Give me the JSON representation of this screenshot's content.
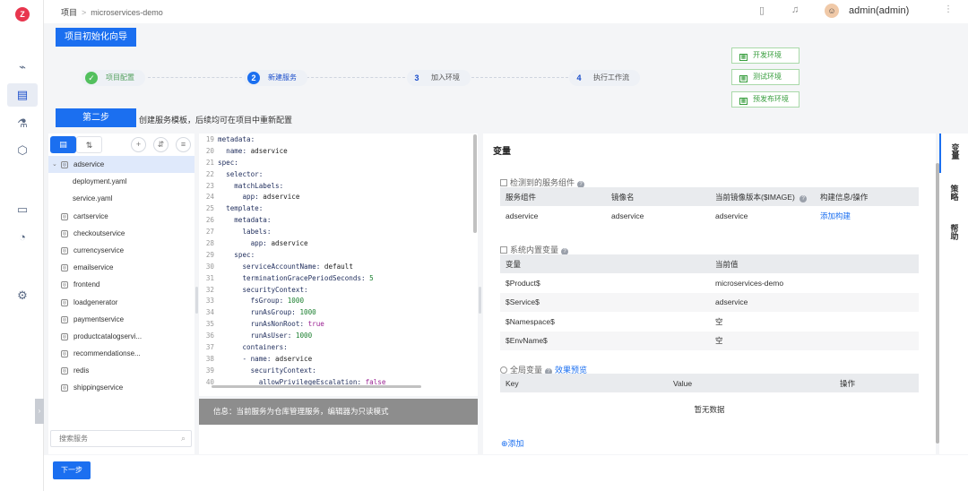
{
  "header": {
    "breadcrumb_root": "项目",
    "breadcrumb_sep": ">",
    "breadcrumb_current": "microservices-demo",
    "user_name": "admin(admin)"
  },
  "wizard": {
    "title_button": "项目初始化向导",
    "steps": [
      {
        "num": "✓",
        "label": "项目配置",
        "state": "done"
      },
      {
        "num": "2",
        "label": "新建服务",
        "state": "active"
      },
      {
        "num": "3",
        "label": "加入环境",
        "state": "todo"
      },
      {
        "num": "4",
        "label": "执行工作流",
        "state": "todo"
      }
    ],
    "env_buttons": [
      "开发环境",
      "测试环境",
      "预发布环境"
    ],
    "step_tag": "第二步",
    "step_desc": "创建服务模板，后续均可在项目中重新配置"
  },
  "services": {
    "selected": "adservice",
    "files": [
      "deployment.yaml",
      "service.yaml"
    ],
    "items": [
      "cartservice",
      "checkoutservice",
      "currencyservice",
      "emailservice",
      "frontend",
      "loadgenerator",
      "paymentservice",
      "productcatalogservi...",
      "recommendationse...",
      "redis",
      "shippingservice"
    ],
    "search_placeholder": "搜索服务"
  },
  "editor": {
    "lines": [
      {
        "n": "19",
        "indent": "",
        "key": "metadata:",
        "val": "",
        "type": "k"
      },
      {
        "n": "20",
        "indent": "  ",
        "key": "name:",
        "val": " adservice",
        "type": "v"
      },
      {
        "n": "21",
        "indent": "",
        "key": "spec:",
        "val": "",
        "type": "k"
      },
      {
        "n": "22",
        "indent": "  ",
        "key": "selector:",
        "val": "",
        "type": "k"
      },
      {
        "n": "23",
        "indent": "    ",
        "key": "matchLabels:",
        "val": "",
        "type": "k"
      },
      {
        "n": "24",
        "indent": "      ",
        "key": "app:",
        "val": " adservice",
        "type": "v"
      },
      {
        "n": "25",
        "indent": "  ",
        "key": "template:",
        "val": "",
        "type": "k"
      },
      {
        "n": "26",
        "indent": "    ",
        "key": "metadata:",
        "val": "",
        "type": "k"
      },
      {
        "n": "27",
        "indent": "      ",
        "key": "labels:",
        "val": "",
        "type": "k"
      },
      {
        "n": "28",
        "indent": "        ",
        "key": "app:",
        "val": " adservice",
        "type": "v"
      },
      {
        "n": "29",
        "indent": "    ",
        "key": "spec:",
        "val": "",
        "type": "k"
      },
      {
        "n": "30",
        "indent": "      ",
        "key": "serviceAccountName:",
        "val": " default",
        "type": "v"
      },
      {
        "n": "31",
        "indent": "      ",
        "key": "terminationGracePeriodSeconds:",
        "val": " 5",
        "type": "n"
      },
      {
        "n": "32",
        "indent": "      ",
        "key": "securityContext:",
        "val": "",
        "type": "k"
      },
      {
        "n": "33",
        "indent": "        ",
        "key": "fsGroup:",
        "val": " 1000",
        "type": "n"
      },
      {
        "n": "34",
        "indent": "        ",
        "key": "runAsGroup:",
        "val": " 1000",
        "type": "n"
      },
      {
        "n": "35",
        "indent": "        ",
        "key": "runAsNonRoot:",
        "val": " true",
        "type": "b"
      },
      {
        "n": "36",
        "indent": "        ",
        "key": "runAsUser:",
        "val": " 1000",
        "type": "n"
      },
      {
        "n": "37",
        "indent": "      ",
        "key": "containers:",
        "val": "",
        "type": "k"
      },
      {
        "n": "38",
        "indent": "      ",
        "key": "- name:",
        "val": " adservice",
        "type": "v"
      },
      {
        "n": "39",
        "indent": "        ",
        "key": "securityContext:",
        "val": "",
        "type": "k"
      },
      {
        "n": "40",
        "indent": "          ",
        "key": "allowPrivilegeEscalation:",
        "val": " false",
        "type": "b"
      }
    ],
    "info": "信息：当前服务为仓库管理服务，编辑器为只读模式"
  },
  "variables": {
    "title": "变量",
    "detected": {
      "title": "检测到的服务组件",
      "headers": [
        "服务组件",
        "镜像名",
        "当前镜像版本($IMAGE)",
        "构建信息/操作"
      ],
      "rows": [
        [
          "adservice",
          "adservice",
          "adservice",
          "添加构建"
        ]
      ]
    },
    "builtin": {
      "title": "系统内置变量",
      "headers": [
        "变量",
        "当前值"
      ],
      "rows": [
        [
          "$Product$",
          "microservices-demo"
        ],
        [
          "$Service$",
          "adservice"
        ],
        [
          "$Namespace$",
          "空"
        ],
        [
          "$EnvName$",
          "空"
        ]
      ]
    },
    "global": {
      "title": "全局变量",
      "preview_link": "效果预览",
      "headers": [
        "Key",
        "Value",
        "操作"
      ],
      "empty": "暂无数据",
      "add_label": "⊕添加"
    }
  },
  "side_tabs": [
    "变量",
    "策略",
    "帮助"
  ],
  "footer": {
    "next_label": "下一步"
  }
}
